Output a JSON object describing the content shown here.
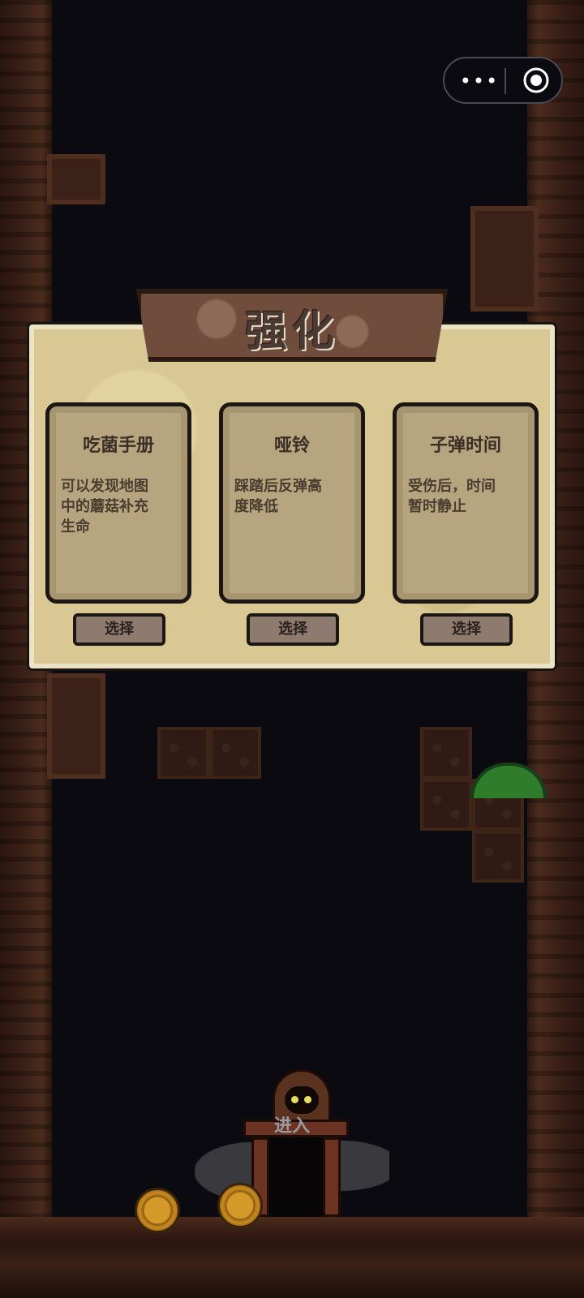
{
  "capsule": {
    "more_icon": "more-dots-icon",
    "target_icon": "target-icon",
    "dots": "•••"
  },
  "upgrade_panel": {
    "title": "强化",
    "options": [
      {
        "name": "吃菌手册",
        "description": "可以发现地图中的蘑菇补充生命",
        "button": "选择"
      },
      {
        "name": "哑铃",
        "description": "踩踏后反弹高度降低",
        "button": "选择"
      },
      {
        "name": "子弹时间",
        "description": "受伤后，时间暂时静止",
        "button": "选择"
      }
    ]
  },
  "scene": {
    "enter_label": "进入"
  },
  "colors": {
    "background": "#0b0a10",
    "panel": "#d9c894",
    "plank": "#6f4c3c",
    "card": "#b6a57e",
    "button": "#8f7a70"
  }
}
